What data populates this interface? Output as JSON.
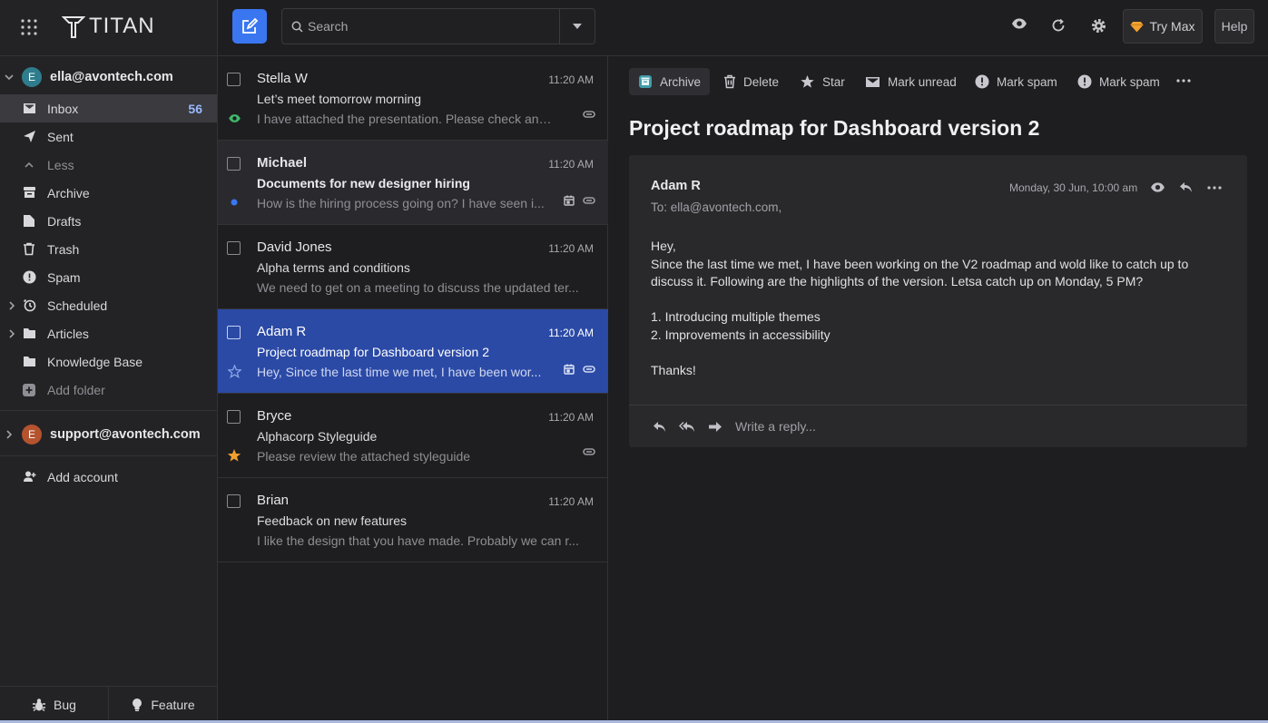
{
  "app": {
    "logo": "TITAN"
  },
  "accounts": [
    {
      "email": "ella@avontech.com",
      "initial": "E",
      "color": "#2f7d8c"
    },
    {
      "email": "support@avontech.com",
      "initial": "E",
      "color": "#b5532f"
    }
  ],
  "nav": [
    {
      "label": "Inbox",
      "icon": "inbox-icon",
      "count": "56"
    },
    {
      "label": "Sent",
      "icon": "send-icon"
    },
    {
      "label": "Less",
      "icon": "chevron-up-icon"
    },
    {
      "label": "Archive",
      "icon": "archive-icon"
    },
    {
      "label": "Drafts",
      "icon": "drafts-icon"
    },
    {
      "label": "Trash",
      "icon": "trash-icon"
    },
    {
      "label": "Spam",
      "icon": "spam-icon"
    },
    {
      "label": "Scheduled",
      "icon": "clock-icon"
    },
    {
      "label": "Articles",
      "icon": "folder-icon"
    },
    {
      "label": "Knowledge Base",
      "icon": "folder-icon"
    },
    {
      "label": "Add folder",
      "icon": "plus-circle-icon"
    }
  ],
  "add_account": "Add account",
  "footer": {
    "bug": "Bug",
    "feature": "Feature"
  },
  "search": {
    "placeholder": "Search"
  },
  "topbar": {
    "try_max": "Try Max",
    "help": "Help"
  },
  "emails": [
    {
      "sender": "Stella W",
      "time": "11:20 AM",
      "subject": "Let’s meet tomorrow morning",
      "preview": "I have attached the presentation. Please check and l...",
      "marker": "eye"
    },
    {
      "sender": "Michael",
      "time": "11:20 AM",
      "subject": "Documents for new designer hiring",
      "preview": "How is the hiring process going on? I have seen i...",
      "marker": "unread"
    },
    {
      "sender": "David Jones",
      "time": "11:20 AM",
      "subject": "Alpha terms and conditions",
      "preview": "We need to get on a meeting to discuss the updated ter...",
      "marker": "none"
    },
    {
      "sender": "Adam R",
      "time": "11:20 AM",
      "subject": "Project roadmap for Dashboard version 2",
      "preview": "Hey, Since the last time we met, I have been wor...",
      "marker": "star-outline"
    },
    {
      "sender": "Bryce",
      "time": "11:20 AM",
      "subject": "Alphacorp Styleguide",
      "preview": "Please review the attached styleguide",
      "marker": "star"
    },
    {
      "sender": "Brian",
      "time": "11:20 AM",
      "subject": "Feedback on new features",
      "preview": "I like the design that you have made. Probably we can r...",
      "marker": "none"
    }
  ],
  "actions": [
    {
      "label": "Archive"
    },
    {
      "label": "Delete"
    },
    {
      "label": "Star"
    },
    {
      "label": "Mark unread"
    },
    {
      "label": "Mark spam"
    },
    {
      "label": "Mark spam"
    }
  ],
  "message": {
    "title": "Project roadmap for Dashboard version 2",
    "from": "Adam R",
    "to": "To: ella@avontech.com,",
    "date": "Monday, 30 Jun, 10:00 am",
    "greeting": "Hey,",
    "paragraph": "Since the last time we met, I have been working on the V2 roadmap and wold like to catch up to discuss it. Following are the highlights of the version. Letsa catch up on Monday, 5 PM?",
    "list": [
      "1. Introducing multiple themes",
      "2. Improvements in accessibility"
    ],
    "closing": "Thanks!",
    "reply_placeholder": "Write a reply..."
  }
}
